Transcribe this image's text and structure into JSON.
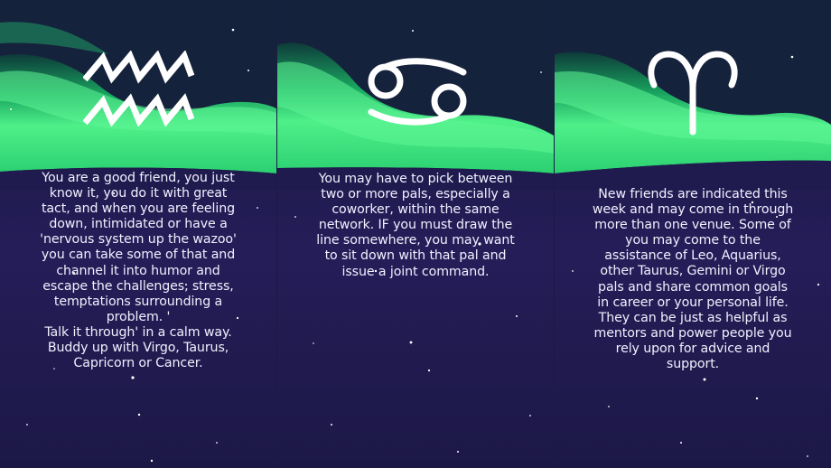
{
  "panels": [
    {
      "sign_icon": "aquarius-icon",
      "text": "You are a good friend, you just\nknow it, you do it with great\ntact, and when you are feeling\ndown, intimidated or have a\n'nervous system up the wazoo'\nyou can take some of that and\nchannel it into humor and\nescape the challenges, stress,\ntemptations surrounding a\nproblem. '\nTalk it through' in a calm way.\nBuddy up with Virgo, Taurus,\nCapricorn or Cancer."
    },
    {
      "sign_icon": "cancer-icon",
      "text": "You may have to pick between\ntwo or more pals, especially a\ncoworker, within the same\nnetwork. IF you must draw the\nline somewhere, you may want\nto sit down with that pal and\nissue a joint command."
    },
    {
      "sign_icon": "aries-icon",
      "text": "New friends are indicated this\nweek and may come in through\nmore than one venue. Some of\nyou may come to the\nassistance of Leo, Aquarius,\nother Taurus, Gemini or Virgo\npals and share common goals\nin career or your personal life.\nThey can be just as helpful as\nmentors and power people you\nrely upon for advice and\nsupport."
    }
  ],
  "colors": {
    "aurora": "#3ff07a",
    "sky": "#231c55",
    "text": "#f2f0ff"
  }
}
